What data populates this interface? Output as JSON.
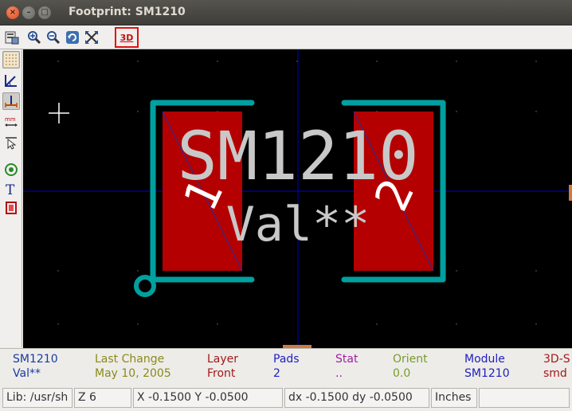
{
  "window": {
    "title": "Footprint: SM1210"
  },
  "toolbar": {
    "buttons": [
      "module-editor-icon",
      "zoom-in-icon",
      "zoom-out-icon",
      "redraw-icon",
      "zoom-fit-icon",
      "3d-view"
    ],
    "three_d_label": "3D"
  },
  "left_toolbar": {
    "tools": [
      "grid-icon",
      "polar-coords-icon",
      "units-inch-icon",
      "units-mm-icon",
      "cursor-shape-icon",
      "pad-icon",
      "text-icon",
      "module-icon"
    ]
  },
  "canvas": {
    "reference_text": "SM1210",
    "value_text": "Val**",
    "pad1_number": "1",
    "pad2_number": "2",
    "colors": {
      "background": "#000000",
      "pad": "#b40000",
      "silkscreen": "#00a0a0",
      "text": "#c8c8c8",
      "axis": "#0000cc"
    }
  },
  "info_panel": {
    "columns": [
      {
        "header": "SM1210",
        "value": "Val**",
        "header_color": "#1b3aa1",
        "value_color": "#1b3aa1"
      },
      {
        "header": "Last Change",
        "value": "May 10, 2005",
        "header_color": "#8a8a1a",
        "value_color": "#8a8a1a"
      },
      {
        "header": "Layer",
        "value": "Front",
        "header_color": "#a01a1a",
        "value_color": "#a01a1a"
      },
      {
        "header": "Pads",
        "value": "2",
        "header_color": "#2020c0",
        "value_color": "#2020c0"
      },
      {
        "header": "Stat",
        "value": "..",
        "header_color": "#a020a0",
        "value_color": "#a020a0"
      },
      {
        "header": "Orient",
        "value": "0.0",
        "header_color": "#7a9a2a",
        "value_color": "#7a9a2a"
      },
      {
        "header": "Module",
        "value": "SM1210",
        "header_color": "#2020c0",
        "value_color": "#2020c0"
      },
      {
        "header": "3D-S",
        "value": "smd",
        "header_color": "#a01a1a",
        "value_color": "#a01a1a"
      }
    ]
  },
  "status_bar": {
    "lib": "Lib: /usr/sh",
    "zoom": "Z 6",
    "coords": "X -0.1500  Y -0.0500",
    "delta": "dx -0.1500  dy -0.0500",
    "units": "Inches",
    "extra": ""
  }
}
